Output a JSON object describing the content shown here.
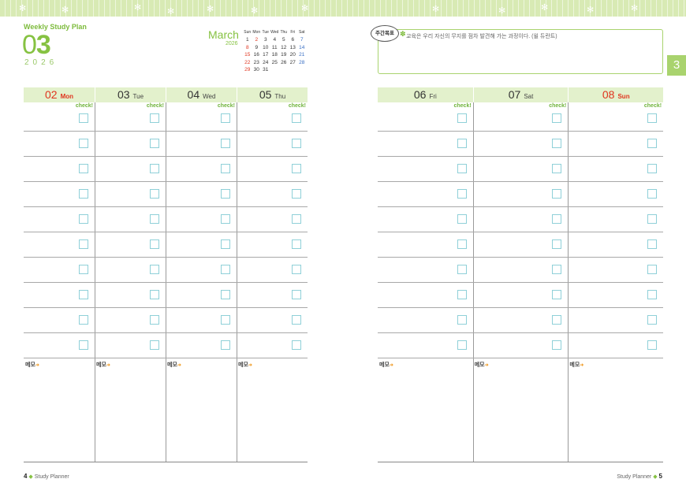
{
  "header": {
    "title": "Weekly Study Plan",
    "big_month_first": "0",
    "big_month_second": "3",
    "year": "2026"
  },
  "mini_calendar": {
    "month": "March",
    "year": "2026",
    "weekdays": [
      "Sun",
      "Mon",
      "Tue",
      "Wed",
      "Thu",
      "Fri",
      "Sat"
    ],
    "weeks": [
      [
        "",
        "1",
        "2",
        "3",
        "4",
        "5",
        "6",
        "7"
      ],
      [
        "8",
        "9",
        "10",
        "11",
        "12",
        "13",
        "14"
      ],
      [
        "15",
        "16",
        "17",
        "18",
        "19",
        "20",
        "21"
      ],
      [
        "22",
        "23",
        "24",
        "25",
        "26",
        "27",
        "28"
      ],
      [
        "29",
        "30",
        "31",
        "",
        "",
        "",
        ""
      ]
    ],
    "highlight_color": "#e0341e",
    "saturday_color": "#3a6fc4"
  },
  "weekly_goal": {
    "label": "주간목표",
    "quote": "교육은 우리 자신의 무지를 점차 발견해 가는 과정이다. (윌 듀란트)"
  },
  "side_tab": "3",
  "check_label": "check!",
  "memo_label": "메모",
  "days_left": [
    {
      "num": "02",
      "name": "Mon",
      "highlight": true
    },
    {
      "num": "03",
      "name": "Tue",
      "highlight": false
    },
    {
      "num": "04",
      "name": "Wed",
      "highlight": false
    },
    {
      "num": "05",
      "name": "Thu",
      "highlight": false
    }
  ],
  "days_right": [
    {
      "num": "06",
      "name": "Fri",
      "highlight": false
    },
    {
      "num": "07",
      "name": "Sat",
      "highlight": false
    },
    {
      "num": "08",
      "name": "Sun",
      "highlight": true
    }
  ],
  "footer": {
    "left_num": "4",
    "left_text": "Study Planner",
    "right_text": "Study Planner",
    "right_num": "5"
  },
  "colors": {
    "accent_green": "#86c242",
    "checkbox_border": "#8fd0d8",
    "sunday_red": "#e0341e"
  }
}
